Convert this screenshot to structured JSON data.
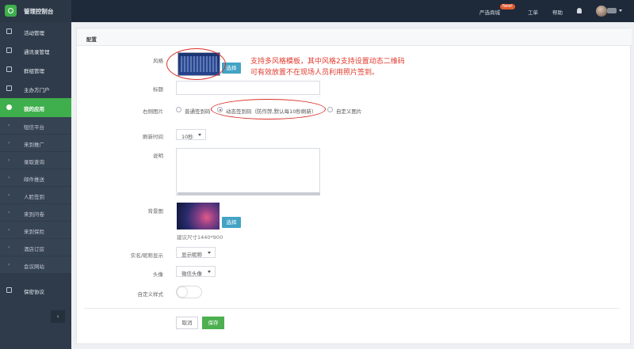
{
  "app": {
    "title": "管理控制台"
  },
  "topbar": {
    "mall": "严选商城",
    "mall_badge": "New!",
    "ticket": "工单",
    "help": "帮助"
  },
  "sidebar": {
    "groups": [
      {
        "label": "活动管理",
        "icon": "home-icon"
      },
      {
        "label": "通讯录管理",
        "icon": "book-icon"
      },
      {
        "label": "群组管理",
        "icon": "group-icon"
      },
      {
        "label": "主办方门户",
        "icon": "list-icon"
      }
    ],
    "active": {
      "label": "我的应用",
      "icon": "app-icon"
    },
    "subitems": [
      "短信平台",
      "来到推广",
      "录取查询",
      "邮件推送",
      "人脸签到",
      "来到问卷",
      "来到保险",
      "酒店订房",
      "会议网站"
    ],
    "footer_item": {
      "label": "保密协议",
      "icon": "document-icon"
    },
    "collapse_label": "‹"
  },
  "panel": {
    "title": "配置",
    "style_label": "风格",
    "choose_label": "选择",
    "annotation_line1": "支持多风格模板，其中风格2支持设置动态二维码",
    "annotation_line2": "可有效放置不在现场人员利用照片签到。",
    "title_label": "标题",
    "right_image_label": "右侧图片",
    "radio_options": [
      "普通签到码",
      "动态签到码（防作弊,默认每10秒刷新）",
      "自定义图片"
    ],
    "refresh_label": "刷新时间",
    "refresh_value": "10秒",
    "desc_label": "说明",
    "bg_label": "背景图",
    "bg_choose": "选择",
    "bg_hint": "建议尺寸1440*900",
    "name_label": "实名/昵称显示",
    "name_value": "显示昵称",
    "avatar_label": "头像",
    "avatar_value": "微信头像",
    "custom_style_label": "自定义样式",
    "cancel": "取消",
    "save": "保存"
  },
  "colors": {
    "accent": "#3fae4c",
    "topbar": "#1e2a3a",
    "sidebar": "#2f3b4b",
    "annotation": "#e03a2c",
    "choose_button": "#43a3c5"
  }
}
